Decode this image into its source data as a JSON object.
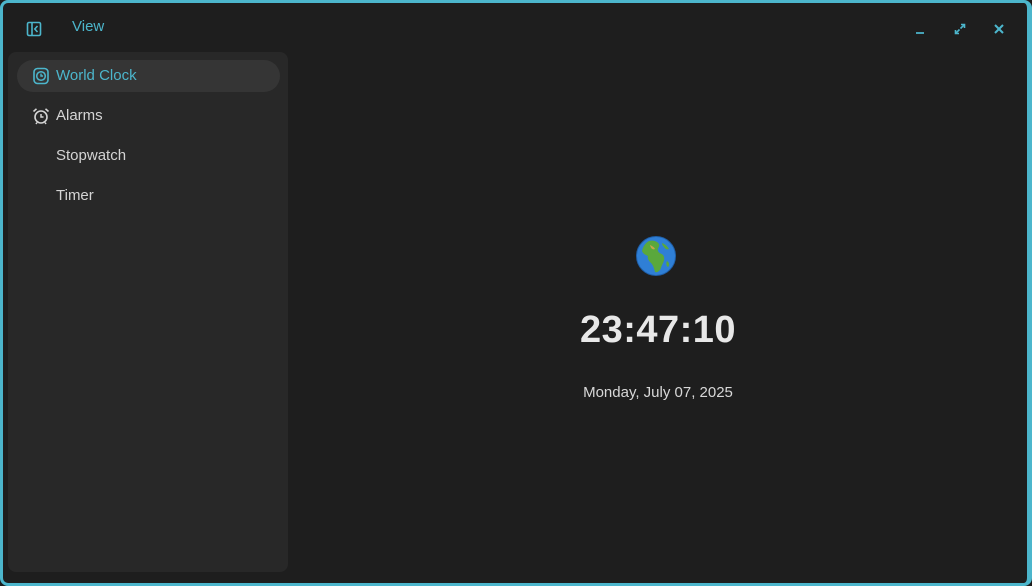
{
  "titlebar": {
    "view_label": "View",
    "icons": {
      "sidebar_toggle": "sidebar-toggle-icon",
      "minimize": "minimize-icon",
      "maximize": "maximize-icon",
      "close": "close-icon"
    }
  },
  "sidebar": {
    "items": [
      {
        "label": "World Clock",
        "icon": "world-clock-icon",
        "active": true
      },
      {
        "label": "Alarms",
        "icon": "alarm-icon",
        "active": false
      },
      {
        "label": "Stopwatch",
        "icon": "",
        "active": false
      },
      {
        "label": "Timer",
        "icon": "",
        "active": false
      }
    ]
  },
  "main": {
    "globe_icon": "globe-icon",
    "time": "23:47:10",
    "date": "Monday, July 07, 2025"
  },
  "colors": {
    "accent": "#4cb6cc",
    "background": "#1e1e1e",
    "sidebar": "#282828",
    "active_item": "#353535",
    "text": "#d4d4d4"
  }
}
